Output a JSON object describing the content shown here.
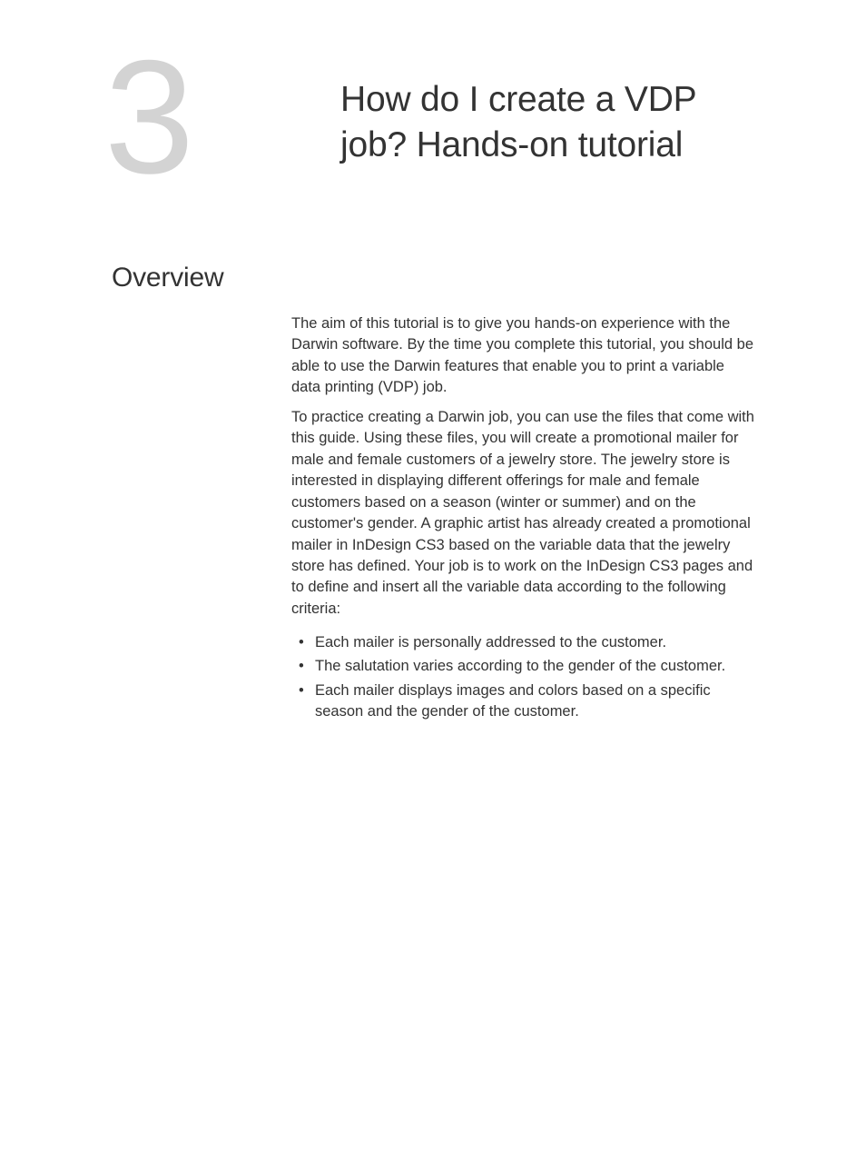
{
  "chapter": {
    "number": "3",
    "title": "How do I create a VDP job? Hands-on tutorial"
  },
  "section": {
    "heading": "Overview",
    "paragraphs": [
      "The aim of this tutorial is to give you hands-on experience with the Darwin software. By the time you complete this tutorial, you should be able to use the Darwin features that enable you to print a variable data printing (VDP) job.",
      "To practice creating a Darwin job, you can use the files that come with this guide. Using these files, you will create a promotional mailer for male and female customers of a jewelry store. The jewelry store is interested in displaying different offerings for male and female customers based on a season (winter or summer) and on the customer's gender. A graphic artist has already created a promotional mailer in InDesign CS3 based on the variable data that the jewelry store has defined. Your job is to work on the InDesign CS3 pages and to define and insert all the variable data according to the following criteria:"
    ],
    "bullets": [
      "Each mailer is personally addressed to the customer.",
      "The salutation varies according to the gender of the customer.",
      "Each mailer displays images and colors based on a specific season and the gender of the customer."
    ]
  }
}
